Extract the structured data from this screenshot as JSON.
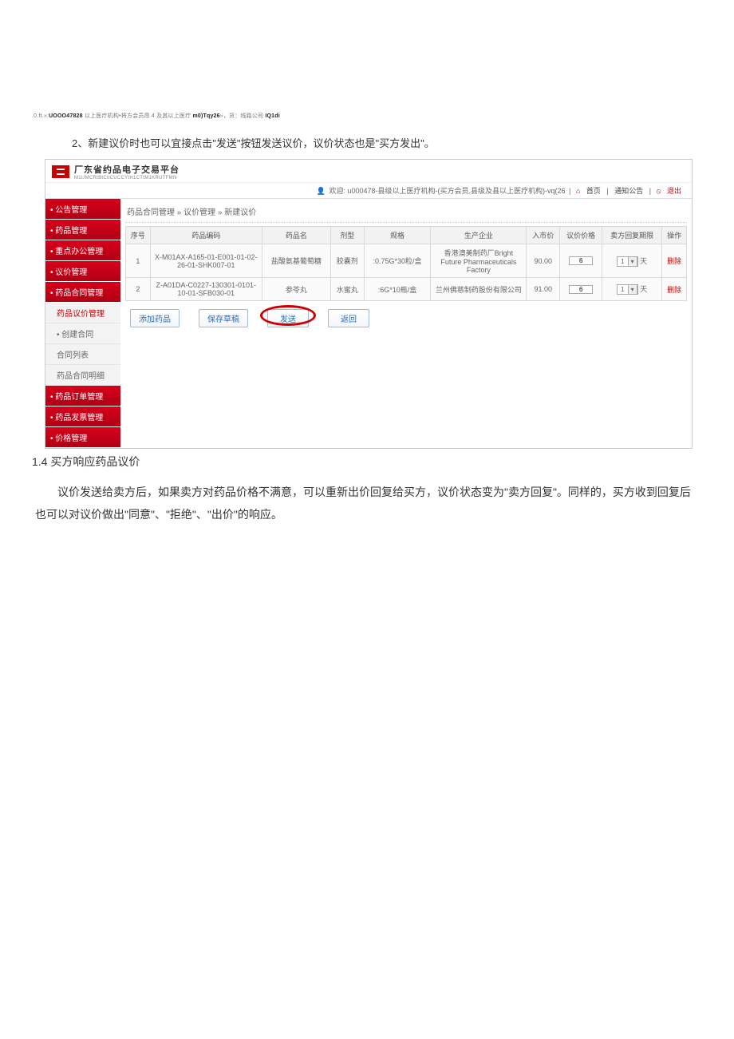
{
  "tiny_header": {
    "pre": ".0.ft.»:",
    "code1": "UOOO47828",
    "mid1": " 以上医疗机构•将方会员昂 4 及其以上医疗 ",
    "code2": "m0)Tqy26",
    "mid2": "»，货：线路公司 ",
    "code3": "IQ1di"
  },
  "instruction": "2、新建议价时也可以宜接点击\"发送\"按钮发送议价，议价状态也是\"买方发出\"。",
  "app": {
    "title": "厂东省约品电子交易平台",
    "subtitle": "M1UMCRtBtCltCUCCYtH1CTtM1KRUTFMN"
  },
  "crumb": {
    "welcome": "欢迎: u000478-县级以上医疗机构-(买方会员,县级及县以上医疗机构)-vq(26",
    "home": "首页",
    "notice": "通知公告",
    "exit": "退出"
  },
  "sidebar": {
    "items": [
      {
        "label": "• 公告管理",
        "type": "main"
      },
      {
        "label": "• 药品管理",
        "type": "main"
      },
      {
        "label": "• 重点办公管理",
        "type": "main"
      },
      {
        "label": "• 议价管理",
        "type": "main"
      },
      {
        "label": "• 药品合同管理",
        "type": "main"
      },
      {
        "label": "药品议价管理",
        "type": "sub",
        "active": true
      },
      {
        "label": "• 创建合同",
        "type": "sub"
      },
      {
        "label": "合同列表",
        "type": "sub"
      },
      {
        "label": "药品合同明细",
        "type": "sub"
      },
      {
        "label": "• 药品订单管理",
        "type": "main"
      },
      {
        "label": "• 药品发票管理",
        "type": "main"
      },
      {
        "label": "• 价格管理",
        "type": "main"
      }
    ]
  },
  "breadcrumb": "药品合同管理 » 议价管理 » 新建议价",
  "table": {
    "headers": [
      "序号",
      "药品编码",
      "药品名",
      "剂型",
      "规格",
      "生产企业",
      "入市价",
      "议价价格",
      "卖方回复期限",
      "操作"
    ],
    "rows": [
      {
        "idx": "1",
        "code": "X-M01AX-A165-01-E001-01-02-26-01-SHK007-01",
        "name": "盐酸氨基葡萄糖",
        "form": "胶囊剂",
        "spec": ":0.75G*30粒/盒",
        "maker": "香港澳美制药厂Bright Future Pharmaceuticals Factory",
        "price": "90.00",
        "bid": "6",
        "days": "1",
        "unit": "天",
        "op": "删除"
      },
      {
        "idx": "2",
        "code": "Z-A01DA-C0227-130301-0101-10-01-SFB030-01",
        "name": "参苓丸",
        "form": "水蜜丸",
        "spec": ":6G*10瓶/盒",
        "maker": "兰州佛慈制药股份有限公司",
        "price": "91.00",
        "bid": "6",
        "days": "1",
        "unit": "天",
        "op": "删除"
      }
    ]
  },
  "actions": {
    "add": "添加药品",
    "draft": "保存草稿",
    "send": "发送",
    "back": "返回"
  },
  "section_heading": "1.4 买方响应药品议价",
  "body_text": "议价发送给卖方后，如果卖方对药品价格不满意，可以重新出价回复给买方，议价状态变为\"卖方回复\"。同样的，买方收到回复后也可以对议价做出\"同意\"、\"拒绝\"、\"出价\"的响应。"
}
